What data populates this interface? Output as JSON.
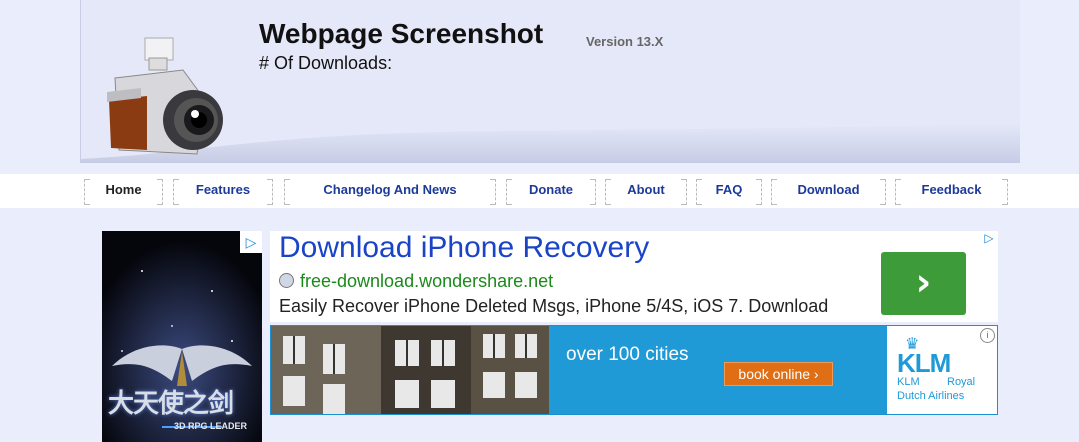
{
  "header": {
    "title": "Webpage Screenshot",
    "version": "Version 13.X",
    "downloads_label": "# Of Downloads:"
  },
  "nav": {
    "items": [
      {
        "label": "Home",
        "active": true
      },
      {
        "label": "Features"
      },
      {
        "label": "Changelog And News"
      },
      {
        "label": "Donate"
      },
      {
        "label": "About"
      },
      {
        "label": "FAQ"
      },
      {
        "label": "Download"
      },
      {
        "label": "Feedback"
      }
    ]
  },
  "ads": {
    "side": {
      "title": "大天使之剑",
      "subtitle": "3D RPG LEADER"
    },
    "text_ad": {
      "title": "Download iPhone Recovery",
      "url": "free-download.wondershare.net",
      "description": "Easily Recover iPhone Deleted Msgs, iPhone 5/4S, iOS 7. Download",
      "button_glyph": "›"
    },
    "banner": {
      "tagline": "over 100 cities",
      "button_label": "book online ›",
      "brand": "KLM",
      "sub1": "KLM",
      "sub2": "Royal",
      "sub3": "Dutch Airlines"
    }
  },
  "colors": {
    "page_bg": "#eaedfb",
    "header_bg": "#e5e8f8",
    "nav_link": "#1d3a9a",
    "ad_title": "#1a44c8",
    "ad_url": "#1a8a1a",
    "klm_blue": "#1f9ad7"
  }
}
